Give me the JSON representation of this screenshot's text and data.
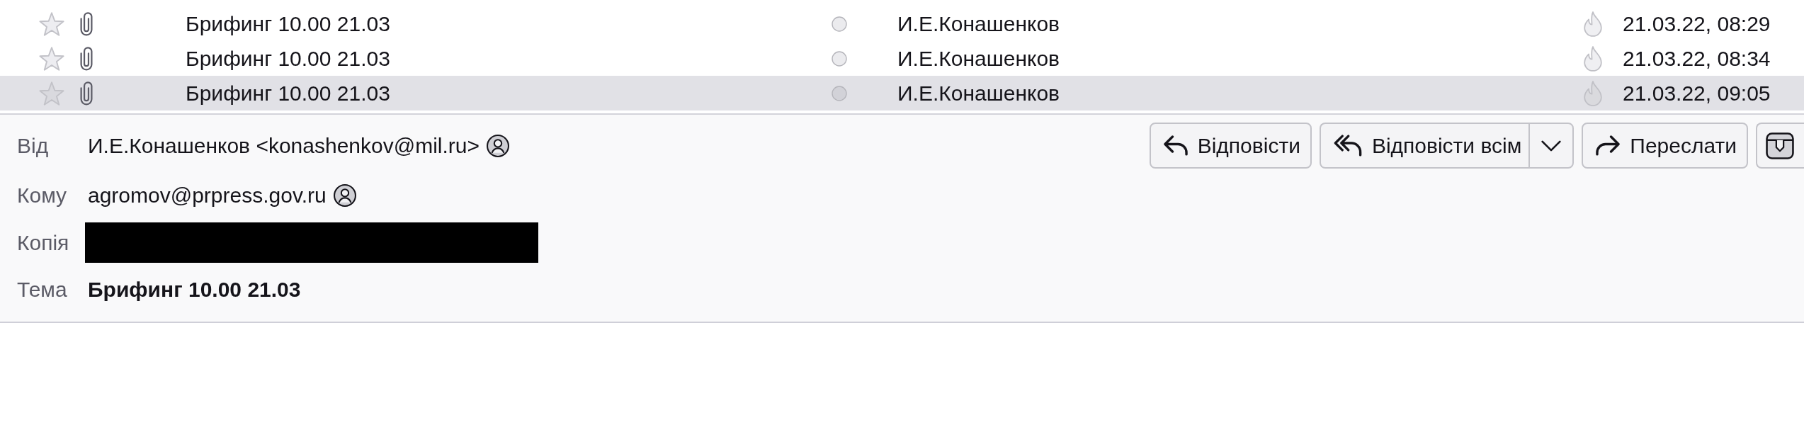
{
  "message_list": {
    "rows": [
      {
        "starred": false,
        "attachment": true,
        "subject": "Брифинг 10.00 21.03",
        "read": true,
        "sender": "И.Е.Конашенков",
        "junk": false,
        "date": "21.03.22, 08:29",
        "selected": false
      },
      {
        "starred": false,
        "attachment": true,
        "subject": "Брифинг 10.00 21.03",
        "read": true,
        "sender": "И.Е.Конашенков",
        "junk": false,
        "date": "21.03.22, 08:34",
        "selected": false
      },
      {
        "starred": false,
        "attachment": true,
        "subject": "Брифинг 10.00 21.03",
        "read": true,
        "sender": "И.Е.Конашенков",
        "junk": false,
        "date": "21.03.22, 09:05",
        "selected": true
      }
    ]
  },
  "header": {
    "fields": [
      {
        "kind": "contact",
        "label": "Від",
        "value": "И.Е.Конашенков <konashenkov@mil.ru>"
      },
      {
        "kind": "contact",
        "label": "Кому",
        "value": "agromov@prpress.gov.ru"
      },
      {
        "kind": "redacted",
        "label": "Копія"
      },
      {
        "kind": "subject",
        "label": "Тема",
        "value": "Брифинг 10.00 21.03"
      }
    ],
    "toolbar": [
      {
        "kind": "reply",
        "label": "Відповісти"
      },
      {
        "kind": "reply-all",
        "label": "Відповісти всім",
        "dropdown": true
      },
      {
        "kind": "forward",
        "label": "Переслати"
      },
      {
        "kind": "archive"
      }
    ]
  }
}
